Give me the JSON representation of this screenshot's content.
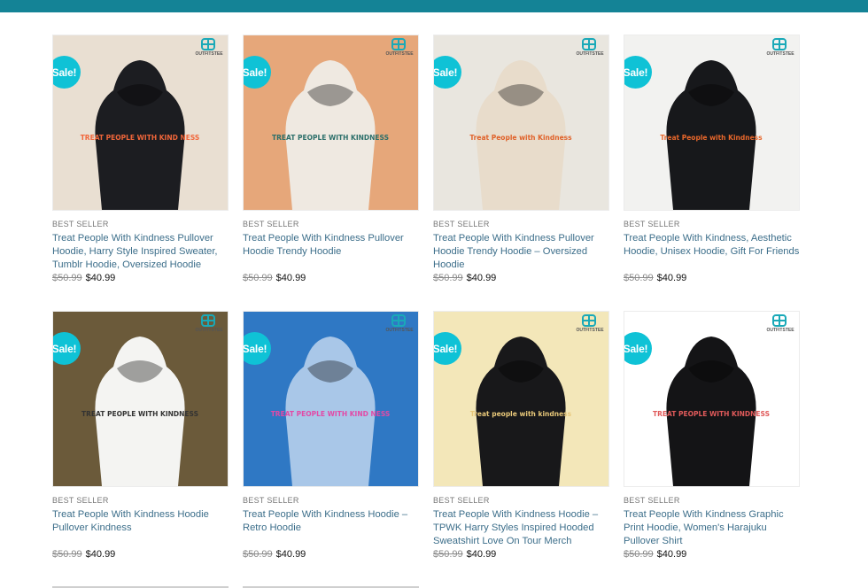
{
  "colors": {
    "top_bar": "#148396",
    "sale_badge": "#0fc2d6",
    "title_link": "#3c6e8a"
  },
  "products": [
    {
      "badge": "Sale!",
      "brand": "OUTFITSTEE",
      "category": "BEST SELLER",
      "title": "Treat People With Kindness Pullover Hoodie, Harry Style Inspired Sweater, Tumblr Hoodie, Oversized Hoodie",
      "old_price": "$50.99",
      "price": "$40.99",
      "image": {
        "bg": "#e9dfd2",
        "garment": "#1c1d21",
        "print": "TREAT PEOPLE WITH KIND NESS",
        "print_color": "#f1663a"
      }
    },
    {
      "badge": "Sale!",
      "brand": "OUTFITSTEE",
      "category": "BEST SELLER",
      "title": "Treat People With Kindness Pullover Hoodie Trendy Hoodie",
      "old_price": "$50.99",
      "price": "$40.99",
      "image": {
        "bg": "#e6a77a",
        "garment": "#efe9e1",
        "print": "TREAT PEOPLE WITH KINDNESS",
        "print_color": "#2c6f6a"
      }
    },
    {
      "badge": "Sale!",
      "brand": "OUTFITSTEE",
      "category": "BEST SELLER",
      "title": "Treat People With Kindness Pullover Hoodie Trendy Hoodie – Oversized Hoodie",
      "old_price": "$50.99",
      "price": "$40.99",
      "image": {
        "bg": "#e9e6df",
        "garment": "#e8dccb",
        "print": "Treat People with Kindness",
        "print_color": "#e0622a"
      }
    },
    {
      "badge": "Sale!",
      "brand": "OUTFITSTEE",
      "category": "BEST SELLER",
      "title": "Treat People With Kindness, Aesthetic Hoodie, Unisex Hoodie, Gift For Friends",
      "old_price": "$50.99",
      "price": "$40.99",
      "image": {
        "bg": "#f2f2f0",
        "garment": "#17181b",
        "print": "Treat People with Kindness",
        "print_color": "#e8672b"
      }
    },
    {
      "badge": "Sale!",
      "brand": "OUTFITSTEE",
      "category": "BEST SELLER",
      "title": "Treat People With Kindness Hoodie Pullover Kindness",
      "old_price": "$50.99",
      "price": "$40.99",
      "image": {
        "bg": "#6b5a3a",
        "garment": "#f4f4f2",
        "print": "TREAT PEOPLE WITH KINDNESS",
        "print_color": "#333333"
      }
    },
    {
      "badge": "Sale!",
      "brand": "OUTFITSTEE",
      "category": "BEST SELLER",
      "title": "Treat People With Kindness Hoodie – Retro Hoodie",
      "old_price": "$50.99",
      "price": "$40.99",
      "image": {
        "bg": "#2f78c4",
        "garment": "#a9c7e8",
        "print": "TREAT PEOPLE WITH KIND NESS",
        "print_color": "#e24aa6"
      }
    },
    {
      "badge": "Sale!",
      "brand": "OUTFITSTEE",
      "category": "BEST SELLER",
      "title": "Treat People With Kindness Hoodie – TPWK Harry Styles Inspired Hooded Sweatshirt Love On Tour Merch",
      "old_price": "$50.99",
      "price": "$40.99",
      "image": {
        "bg": "#f3e7b9",
        "garment": "#18181a",
        "print": "Treat people with kindness",
        "print_color": "#e7c779"
      }
    },
    {
      "badge": "Sale!",
      "brand": "OUTFITSTEE",
      "category": "BEST SELLER",
      "title": "Treat People With Kindness Graphic Print Hoodie, Women's Harajuku Pullover Shirt",
      "old_price": "$50.99",
      "price": "$40.99",
      "image": {
        "bg": "#ffffff",
        "garment": "#141416",
        "print": "TREAT PEOPLE WITH KINDNESS",
        "print_color": "#e05a5a"
      }
    }
  ]
}
